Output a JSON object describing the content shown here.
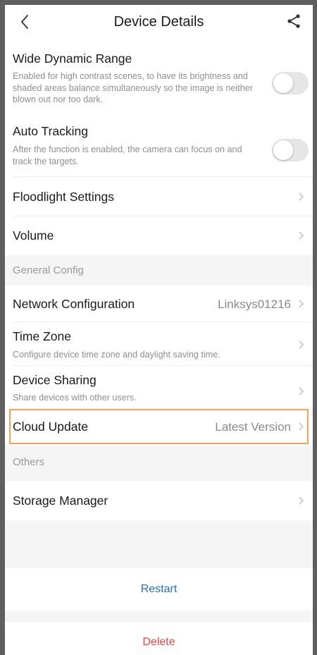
{
  "header": {
    "title": "Device Details",
    "back_icon": "chevron-left-icon",
    "share_icon": "share-icon"
  },
  "settings": {
    "wdr": {
      "title": "Wide Dynamic Range",
      "description": "Enabled for high contrast scenes, to have its brightness and shaded areas balance simultaneously so the image is neither blown out nor too dark.",
      "enabled": false
    },
    "auto_tracking": {
      "title": "Auto Tracking",
      "description": "After the function is enabled, the camera can focus on and track the targets.",
      "enabled": false
    },
    "floodlight": {
      "title": "Floodlight Settings"
    },
    "volume": {
      "title": "Volume"
    }
  },
  "general": {
    "section_label": "General Config",
    "network": {
      "title": "Network Configuration",
      "value": "Linksys01216"
    },
    "timezone": {
      "title": "Time Zone",
      "description": "Configure device time zone and daylight saving time."
    },
    "sharing": {
      "title": "Device Sharing",
      "description": "Share devices with other users."
    },
    "cloud_update": {
      "title": "Cloud Update",
      "value": "Latest Version"
    }
  },
  "others": {
    "section_label": "Others",
    "storage": {
      "title": "Storage Manager"
    }
  },
  "actions": {
    "restart": "Restart",
    "delete": "Delete"
  },
  "colors": {
    "restart": "#1f6fc5",
    "delete": "#e04b4b",
    "highlight": "#f0a35a",
    "section_bg": "#f5f5f5"
  }
}
